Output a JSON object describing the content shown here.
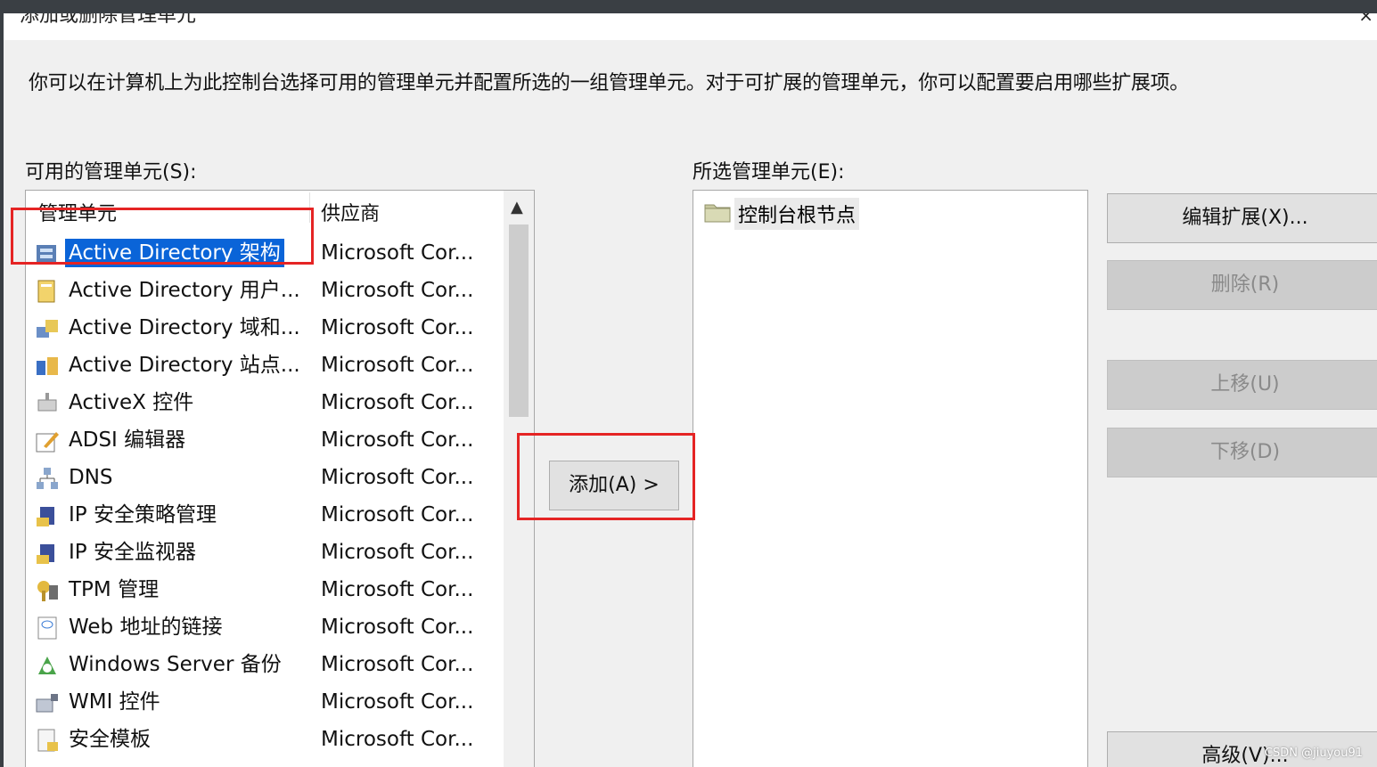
{
  "window": {
    "title": "添加或删除管理单元",
    "close_glyph": "×"
  },
  "description": "你可以在计算机上为此控制台选择可用的管理单元并配置所选的一组管理单元。对于可扩展的管理单元，你可以配置要启用哪些扩展项。",
  "available": {
    "label": "可用的管理单元(S):",
    "columns": [
      "管理单元",
      "供应商"
    ],
    "items": [
      {
        "name": "Active Directory 架构",
        "vendor": "Microsoft Cor...",
        "icon": "schema-icon"
      },
      {
        "name": "Active Directory 用户...",
        "vendor": "Microsoft Cor...",
        "icon": "users-book-icon"
      },
      {
        "name": "Active Directory 域和...",
        "vendor": "Microsoft Cor...",
        "icon": "domains-icon"
      },
      {
        "name": "Active Directory 站点...",
        "vendor": "Microsoft Cor...",
        "icon": "sites-icon"
      },
      {
        "name": "ActiveX 控件",
        "vendor": "Microsoft Cor...",
        "icon": "activex-icon"
      },
      {
        "name": "ADSI 编辑器",
        "vendor": "Microsoft Cor...",
        "icon": "edit-icon"
      },
      {
        "name": "DNS",
        "vendor": "Microsoft Cor...",
        "icon": "dns-icon"
      },
      {
        "name": "IP 安全策略管理",
        "vendor": "Microsoft Cor...",
        "icon": "security-policy-icon"
      },
      {
        "name": "IP 安全监视器",
        "vendor": "Microsoft Cor...",
        "icon": "security-monitor-icon"
      },
      {
        "name": "TPM 管理",
        "vendor": "Microsoft Cor...",
        "icon": "tpm-icon"
      },
      {
        "name": "Web 地址的链接",
        "vendor": "Microsoft Cor...",
        "icon": "web-link-icon"
      },
      {
        "name": "Windows Server 备份",
        "vendor": "Microsoft Cor...",
        "icon": "backup-icon"
      },
      {
        "name": "WMI 控件",
        "vendor": "Microsoft Cor...",
        "icon": "wmi-icon"
      },
      {
        "name": "安全模板",
        "vendor": "Microsoft Cor...",
        "icon": "template-icon"
      }
    ],
    "selected_index": 0,
    "scroll_up": "▲",
    "scroll_down": "▼"
  },
  "selected": {
    "label": "所选管理单元(E):",
    "items": [
      {
        "name": "控制台根节点",
        "icon": "folder-icon"
      }
    ]
  },
  "buttons": {
    "add": "添加(A) >",
    "edit_extensions": "编辑扩展(X)...",
    "remove": "删除(R)",
    "move_up": "上移(U)",
    "move_down": "下移(D)",
    "advanced": "高级(V)..."
  },
  "colors": {
    "selection": "#0a64d8",
    "highlight": "#e52424"
  },
  "watermark": "CSDN @jiuyou91"
}
